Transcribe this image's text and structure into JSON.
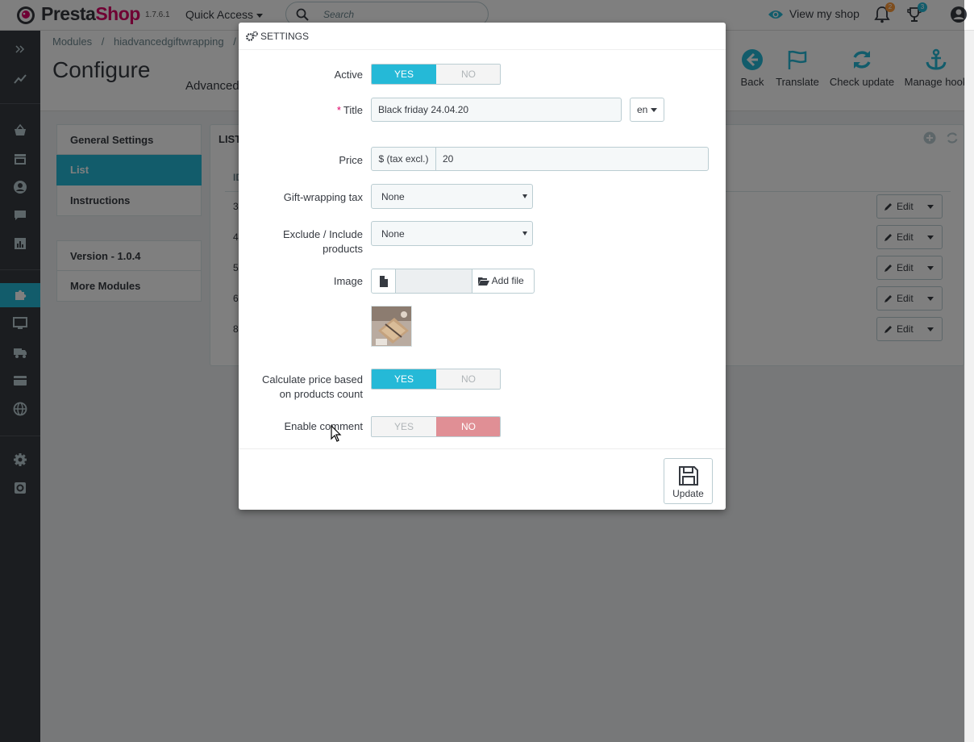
{
  "header": {
    "brand_part1": "Presta",
    "brand_part2": "Shop",
    "version": "1.7.6.1",
    "quick_access": "Quick Access",
    "search_placeholder": "Search",
    "view_shop": "View my shop",
    "orders_badge": "2",
    "customers_badge": "3"
  },
  "page": {
    "breadcrumb": [
      "Modules",
      "/",
      "hiadvancedgiftwrapping",
      "/"
    ],
    "title": "Configure",
    "subtitle": "Advanced",
    "toolbar": [
      {
        "label": "Back",
        "icon": "back-arrow-icon"
      },
      {
        "label": "Translate",
        "icon": "flag-icon"
      },
      {
        "label": "Check update",
        "icon": "refresh-icon"
      },
      {
        "label": "Manage hook",
        "icon": "anchor-icon"
      }
    ]
  },
  "tabs": [
    {
      "label": "General Settings"
    },
    {
      "label": "List"
    },
    {
      "label": "Instructions"
    }
  ],
  "tabs_secondary": [
    {
      "label": "Version - 1.0.4"
    },
    {
      "label": "More Modules"
    }
  ],
  "list_panel": {
    "heading": "LIST",
    "id_col": "ID",
    "rows": [
      "3",
      "4",
      "5",
      "6",
      "8"
    ],
    "edit_label": "Edit"
  },
  "modal": {
    "title": "SETTINGS",
    "yes_label": "YES",
    "no_label": "NO",
    "fields": {
      "active_label": "Active",
      "active_value": "YES",
      "title_label": "Title",
      "title_value": "Black friday 24.04.20",
      "lang": "en",
      "price_label": "Price",
      "price_prefix": "$ (tax excl.)",
      "price_value": "20",
      "tax_label": "Gift-wrapping tax",
      "tax_value": "None",
      "exclude_label_1": "Exclude / Include",
      "exclude_label_2": "products",
      "exclude_value": "None",
      "image_label": "Image",
      "add_file": "Add file",
      "calc_label_1": "Calculate price based",
      "calc_label_2": "on products count",
      "calc_value": "YES",
      "comment_label": "Enable comment",
      "comment_value": "NO"
    },
    "update_label": "Update"
  },
  "colors": {
    "accent": "#25b9d7",
    "sidebar": "#363a41",
    "brand_pink": "#df0067",
    "no_active": "#e08f95"
  }
}
